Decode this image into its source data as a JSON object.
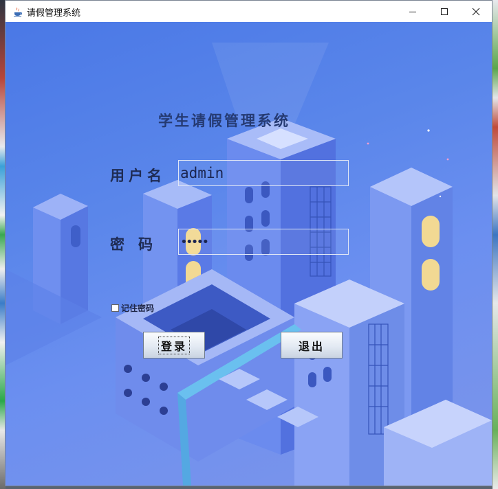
{
  "window": {
    "title": "请假管理系统",
    "controls": {
      "minimize": "minimize",
      "maximize": "maximize",
      "close": "close"
    }
  },
  "login": {
    "heading": "学生请假管理系统",
    "username_label": "用户名",
    "username_value": "admin",
    "password_label": "密码",
    "password_value": "•••••",
    "remember_label": "记住密码",
    "remember_checked": false,
    "login_button": "登录",
    "exit_button": "退出"
  },
  "colors": {
    "background_accent": "#4a78e6",
    "label_color": "#1f2c55"
  }
}
